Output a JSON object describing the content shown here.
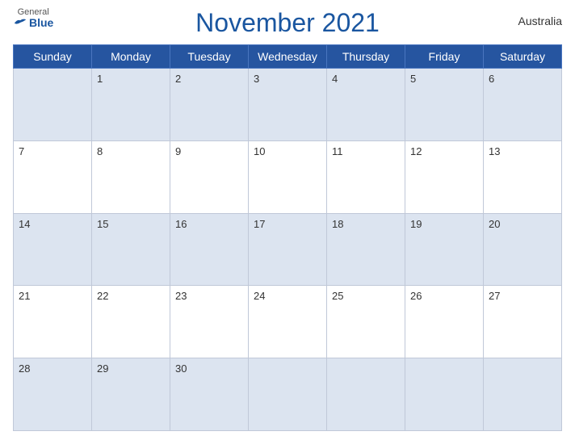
{
  "header": {
    "logo_general": "General",
    "logo_blue": "Blue",
    "title": "November 2021",
    "country": "Australia"
  },
  "weekdays": [
    "Sunday",
    "Monday",
    "Tuesday",
    "Wednesday",
    "Thursday",
    "Friday",
    "Saturday"
  ],
  "weeks": [
    [
      null,
      1,
      2,
      3,
      4,
      5,
      6
    ],
    [
      7,
      8,
      9,
      10,
      11,
      12,
      13
    ],
    [
      14,
      15,
      16,
      17,
      18,
      19,
      20
    ],
    [
      21,
      22,
      23,
      24,
      25,
      26,
      27
    ],
    [
      28,
      29,
      30,
      null,
      null,
      null,
      null
    ]
  ]
}
